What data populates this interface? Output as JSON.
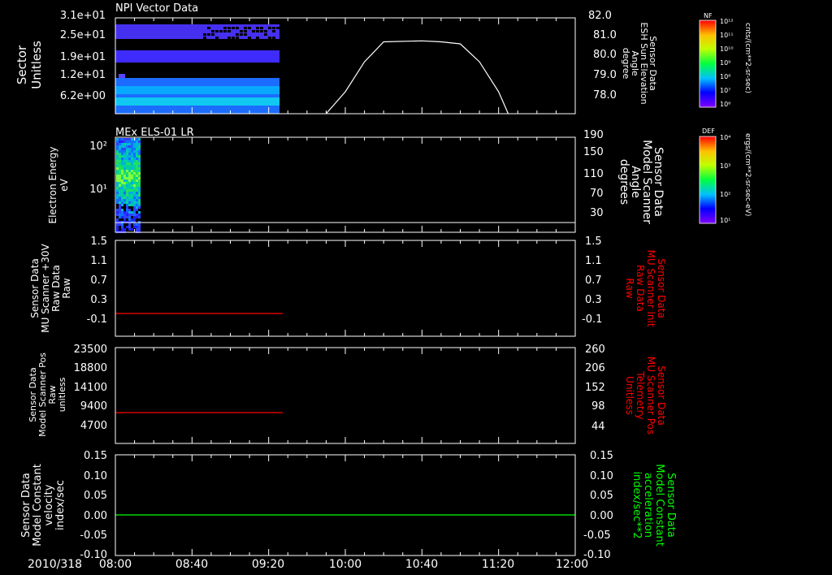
{
  "colors": {
    "background": "#000000",
    "foreground": "#ffffff",
    "red": "#ff0000",
    "green": "#00ff00"
  },
  "date_label": "2010/318",
  "x_axis": {
    "range": [
      "08:00",
      "12:00"
    ],
    "tick_labels": [
      "08:00",
      "08:40",
      "09:20",
      "10:00",
      "10:40",
      "11:20",
      "12:00"
    ]
  },
  "chart_data": [
    {
      "type": "heatmap",
      "title": "NPI Vector Data",
      "left_label": [
        "Sector",
        "Unitless"
      ],
      "left_ticks": [
        "3.1e+01",
        "2.5e+01",
        "1.9e+01",
        "1.2e+01",
        "6.2e+00"
      ],
      "ylim": [
        0,
        31
      ],
      "data_time_range": [
        "08:00",
        "09:25"
      ],
      "overlay": {
        "type": "line",
        "right_label": [
          "Sensor Data",
          "ESH Sun Elevation",
          "Angle",
          "degree"
        ],
        "right_ticks": [
          "82.0",
          "81.0",
          "80.0",
          "79.0",
          "78.0"
        ],
        "ylim": [
          77.2,
          82.0
        ],
        "x": [
          "09:50",
          "10:00",
          "10:10",
          "10:20",
          "10:40",
          "10:50",
          "11:00",
          "11:10",
          "11:20",
          "11:25"
        ],
        "y": [
          77.2,
          78.3,
          79.8,
          80.8,
          80.85,
          80.8,
          80.7,
          79.8,
          78.3,
          77.2
        ]
      },
      "colorbar": {
        "label": "NF",
        "units": "cnts/(cm**2-sr-sec)",
        "tick_labels": [
          "10¹²",
          "10¹¹",
          "10¹⁰",
          "10⁹",
          "10⁸",
          "10⁷",
          "10⁶"
        ]
      }
    },
    {
      "type": "heatmap",
      "title": "MEx ELS-01 LR",
      "left_label": [
        "Electron Energy",
        "eV"
      ],
      "left_ticks": [
        "10²",
        "10¹"
      ],
      "scale": "log",
      "data_time_range": [
        "08:00",
        "08:12"
      ],
      "overlay": {
        "type": "line",
        "right_label": [
          "Sensor Data",
          "Model Scanner",
          "Angle",
          "degrees"
        ],
        "right_ticks": [
          "190",
          "150",
          "110",
          "70",
          "30"
        ],
        "ylim": [
          0,
          190
        ],
        "x": [
          "08:00",
          "12:00"
        ],
        "y": [
          10,
          10
        ]
      },
      "colorbar": {
        "label": "DEF",
        "units": "ergs/(cm**2-sr-sec-eV)",
        "tick_labels": [
          "10⁴",
          "10³",
          "10²",
          "10¹"
        ]
      }
    },
    {
      "type": "line",
      "left_label": [
        "Sensor Data",
        "MU Scanner +30V",
        "Raw Data",
        "Raw"
      ],
      "left_ticks": [
        "1.5",
        "1.1",
        "0.7",
        "0.3",
        "-0.1"
      ],
      "right_label": [
        "Sensor Data",
        "MU Scanner Init",
        "Raw Data",
        "Raw"
      ],
      "right_ticks": [
        "1.5",
        "1.1",
        "0.7",
        "0.3",
        "-0.1"
      ],
      "ylim": [
        -0.4,
        1.5
      ],
      "series": [
        {
          "x": [
            "08:00",
            "09:25"
          ],
          "y": [
            0.0,
            0.0
          ],
          "color": "#ff0000"
        }
      ]
    },
    {
      "type": "line",
      "left_label": [
        "Sensor Data",
        "Model Scanner Pos",
        "Raw",
        "unitless"
      ],
      "left_ticks": [
        "23500",
        "18800",
        "14100",
        "9400",
        "4700"
      ],
      "right_label": [
        "Sensor Data",
        "MU Scanner Pos",
        "Telemetry",
        "Unitless"
      ],
      "right_ticks": [
        "260",
        "206",
        "152",
        "98",
        "44"
      ],
      "ylim": [
        0,
        23500
      ],
      "series": [
        {
          "x": [
            "08:00",
            "09:25"
          ],
          "y": [
            8000,
            8000
          ],
          "color": "#ff0000"
        }
      ]
    },
    {
      "type": "line",
      "left_label": [
        "Sensor Data",
        "Model Constant",
        "velocity",
        "index/sec"
      ],
      "left_ticks": [
        "0.15",
        "0.10",
        "0.05",
        "0.00",
        "-0.05",
        "-0.10"
      ],
      "right_label": [
        "Sensor Data",
        "Model Constant",
        "acceleration",
        "index/sec**2"
      ],
      "right_ticks": [
        "0.15",
        "0.10",
        "0.05",
        "0.00",
        "-0.05",
        "-0.10"
      ],
      "ylim": [
        -0.1,
        0.15
      ],
      "series": [
        {
          "x": [
            "08:00",
            "12:00"
          ],
          "y": [
            0.0,
            0.0
          ],
          "color": "#00ff00"
        }
      ]
    }
  ]
}
